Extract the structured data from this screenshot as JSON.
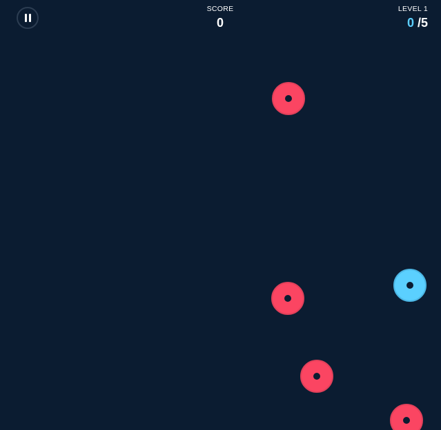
{
  "hud": {
    "score_label": "SCORE",
    "score_value": "0",
    "level_label": "LEVEL 1",
    "level_current": "0",
    "level_separator": "/",
    "level_total": "5",
    "pause_icon": "pause-icon"
  },
  "colors": {
    "background": "#0b1c31",
    "red_target": "#fb4562",
    "blue_target": "#5bd0ff",
    "text": "#ffffff"
  },
  "targets": [
    {
      "color": "red"
    },
    {
      "color": "red"
    },
    {
      "color": "blue"
    },
    {
      "color": "red"
    },
    {
      "color": "red"
    }
  ]
}
